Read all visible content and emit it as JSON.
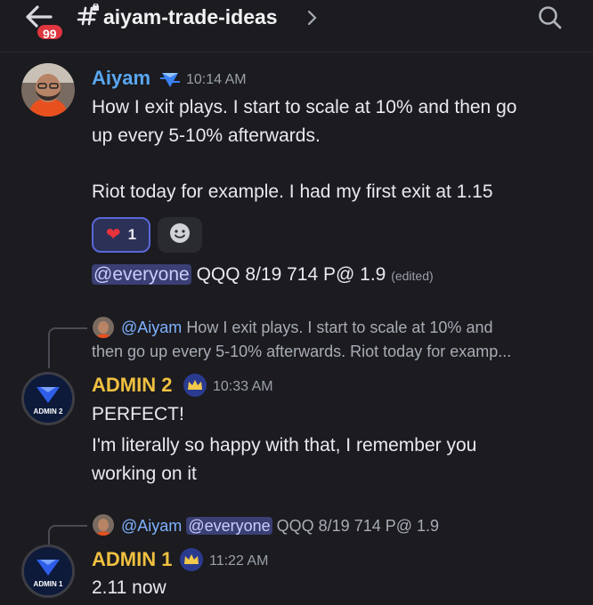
{
  "header": {
    "badge_count": "99",
    "channel_name": "aiyam-trade-ideas"
  },
  "messages": [
    {
      "author": "Aiyam",
      "time": "10:14 AM",
      "lines": [
        "How I exit plays. I start to scale at 10% and then go",
        "up every 5-10% afterwards.",
        "Riot today for example. I had my first exit at 1.15"
      ],
      "reaction": {
        "emoji": "❤️",
        "count": "1"
      },
      "followup": {
        "mention": "@everyone",
        "text": "QQQ 8/19 714 P@ 1.9",
        "edited": "(edited)"
      }
    },
    {
      "author": "ADMIN 2",
      "time": "10:33 AM",
      "avatar_label": "ADMIN 2",
      "reply": {
        "user": "@Aiyam",
        "line1": "How I exit plays. I start to scale at 10% and",
        "line2": "then go up every 5-10% afterwards.   Riot today for examp..."
      },
      "lines": [
        "PERFECT!",
        "I'm literally so happy with that, I remember you",
        "working on it"
      ]
    },
    {
      "author": "ADMIN 1",
      "time": "11:22 AM",
      "avatar_label": "ADMIN 1",
      "reply": {
        "user": "@Aiyam",
        "mention": "@everyone",
        "text": "QQQ 8/19 714 P@ 1.9"
      },
      "lines": [
        "2.11 now"
      ]
    }
  ],
  "colors": {
    "background": "#1b1b20",
    "aiyam_name": "#5aa7f0",
    "admin_name": "#f0c040",
    "mention_bg": "#3a3f74",
    "badge": "#e0363f"
  }
}
